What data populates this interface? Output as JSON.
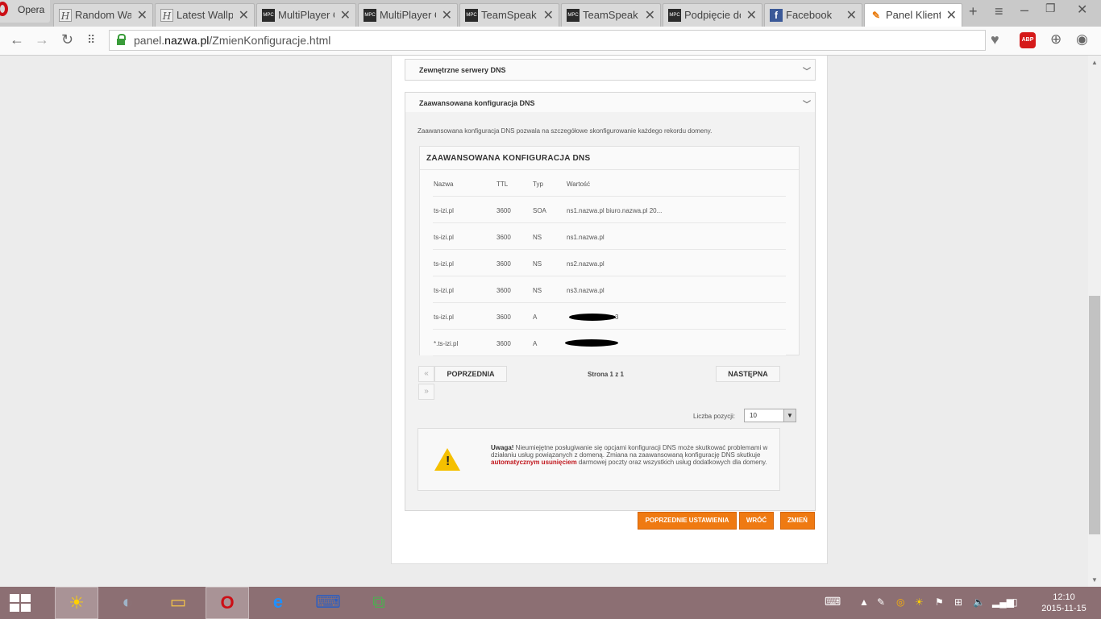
{
  "browser": {
    "opera_label": "Opera",
    "tabs": [
      {
        "label": "Random Wall",
        "favicon": "h-icon"
      },
      {
        "label": "Latest Wallpa",
        "favicon": "h-icon"
      },
      {
        "label": "MultiPlayer C",
        "favicon": "mpc-icon"
      },
      {
        "label": "MultiPlayer C",
        "favicon": "mpc-icon"
      },
      {
        "label": "TeamSpeak |",
        "favicon": "mpc-icon"
      },
      {
        "label": "TeamSpeak -",
        "favicon": "mpc-icon"
      },
      {
        "label": "Podpięcie do",
        "favicon": "mpc-icon"
      },
      {
        "label": "Facebook",
        "favicon": "facebook-icon"
      },
      {
        "label": "Panel Klienta",
        "favicon": "panel-icon",
        "active": true
      }
    ],
    "url_prefix": "panel.",
    "url_domain": "nazwa.pl",
    "url_path": "/ZmienKonfiguracje.html",
    "abp_label": "ABP"
  },
  "page": {
    "section_external": "Zewnętrzne serwery DNS",
    "section_advanced": "Zaawansowana konfiguracja DNS",
    "description": "Zaawansowana konfiguracja DNS pozwala na szczegółowe skonfigurowanie każdego rekordu domeny.",
    "table_title": "ZAAWANSOWANA KONFIGURACJA DNS",
    "columns": [
      "Nazwa",
      "TTL",
      "Typ",
      "Wartość"
    ],
    "rows": [
      {
        "name": "ts-izi.pl",
        "ttl": "3600",
        "type": "SOA",
        "value": "ns1.nazwa.pl biuro.nazwa.pl 20..."
      },
      {
        "name": "ts-izi.pl",
        "ttl": "3600",
        "type": "NS",
        "value": "ns1.nazwa.pl"
      },
      {
        "name": "ts-izi.pl",
        "ttl": "3600",
        "type": "NS",
        "value": "ns2.nazwa.pl"
      },
      {
        "name": "ts-izi.pl",
        "ttl": "3600",
        "type": "NS",
        "value": "ns3.nazwa.pl"
      },
      {
        "name": "ts-izi.pl",
        "ttl": "3600",
        "type": "A",
        "value": "3"
      },
      {
        "name": "*.ts-izi.pl",
        "ttl": "3600",
        "type": "A",
        "value": ""
      }
    ],
    "pager": {
      "first": "«",
      "prev": "POPRZEDNIA",
      "info": "Strona 1 z 1",
      "next": "NASTĘPNA",
      "last": "»"
    },
    "per_page_label": "Liczba pozycji:",
    "per_page_value": "10",
    "warning": {
      "strong": "Uwaga!",
      "text1": " Nieumiejętne posługiwanie się opcjami konfiguracji DNS może skutkować problemami w działaniu usług powiązanych z domeną. Zmiana na zaawansowaną konfigurację DNS skutkuje ",
      "highlight": "automatycznym usunięciem",
      "text2": " darmowej poczty oraz wszystkich usług dodatkowych dla domeny."
    },
    "buttons": {
      "previous_settings": "POPRZEDNIE USTAWIENIA",
      "back": "WRÓĆ",
      "change": "ZMIEŃ"
    }
  },
  "taskbar": {
    "time": "12:10",
    "date": "2015-11-15"
  },
  "colors": {
    "accent_orange": "#ef7a12",
    "warning_red": "#c0161c",
    "taskbar": "#8c6f73"
  }
}
